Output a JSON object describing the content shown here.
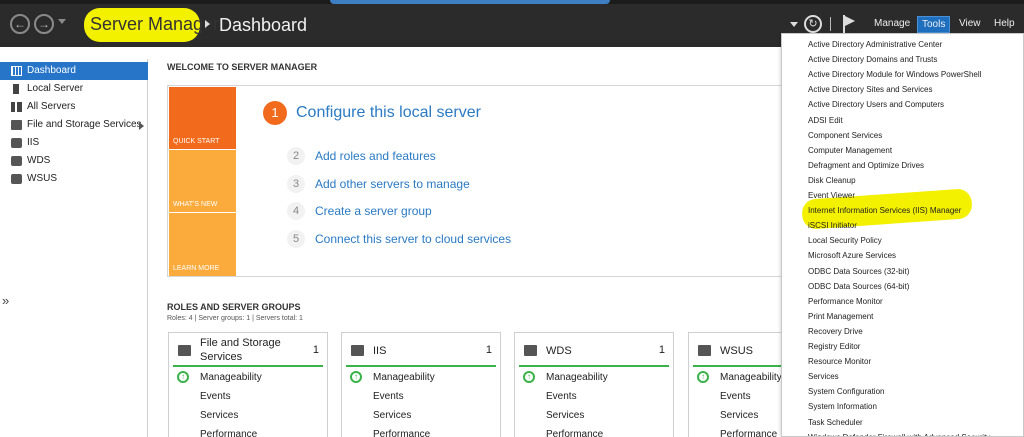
{
  "header": {
    "title": "Server Manager",
    "breadcrumb": "Dashboard",
    "menus": [
      "Manage",
      "Tools",
      "View",
      "Help"
    ]
  },
  "sidebar": {
    "items": [
      {
        "label": "Dashboard",
        "icon": "dashboard-icon",
        "selected": true
      },
      {
        "label": "Local Server",
        "icon": "server-icon"
      },
      {
        "label": "All Servers",
        "icon": "servers-icon"
      },
      {
        "label": "File and Storage Services",
        "icon": "file-storage-icon"
      },
      {
        "label": "IIS",
        "icon": "iis-icon"
      },
      {
        "label": "WDS",
        "icon": "wds-icon"
      },
      {
        "label": "WSUS",
        "icon": "wsus-icon"
      }
    ],
    "collapse_glyph": "»"
  },
  "welcome": {
    "heading": "WELCOME TO SERVER MANAGER",
    "tiles": [
      "QUICK START",
      "WHAT'S NEW",
      "LEARN MORE"
    ],
    "steps": [
      {
        "num": "1",
        "label": "Configure this local server"
      },
      {
        "num": "2",
        "label": "Add roles and features"
      },
      {
        "num": "3",
        "label": "Add other servers to manage"
      },
      {
        "num": "4",
        "label": "Create a server group"
      },
      {
        "num": "5",
        "label": "Connect this server to cloud services"
      }
    ]
  },
  "roles": {
    "heading": "ROLES AND SERVER GROUPS",
    "summary": "Roles: 4   |   Server groups: 1   |   Servers total: 1",
    "cards": [
      {
        "name": "File and Storage Services",
        "count": "1",
        "rows": [
          "Manageability",
          "Events",
          "Services",
          "Performance"
        ]
      },
      {
        "name": "IIS",
        "count": "1",
        "rows": [
          "Manageability",
          "Events",
          "Services",
          "Performance"
        ]
      },
      {
        "name": "WDS",
        "count": "1",
        "rows": [
          "Manageability",
          "Events",
          "Services",
          "Performance"
        ]
      },
      {
        "name": "WSUS",
        "count": "",
        "rows": [
          "Manageability",
          "Events",
          "Services",
          "Performance"
        ]
      }
    ]
  },
  "tools_menu": {
    "items": [
      "Active Directory Administrative Center",
      "Active Directory Domains and Trusts",
      "Active Directory Module for Windows PowerShell",
      "Active Directory Sites and Services",
      "Active Directory Users and Computers",
      "ADSI Edit",
      "Component Services",
      "Computer Management",
      "Defragment and Optimize Drives",
      "Disk Cleanup",
      "Event Viewer",
      "Internet Information Services (IIS) Manager",
      "iSCSI Initiator",
      "Local Security Policy",
      "Microsoft Azure Services",
      "ODBC Data Sources (32-bit)",
      "ODBC Data Sources (64-bit)",
      "Performance Monitor",
      "Print Management",
      "Recovery Drive",
      "Registry Editor",
      "Resource Monitor",
      "Services",
      "System Configuration",
      "System Information",
      "Task Scheduler",
      "Windows Defender Firewall with Advanced Security"
    ],
    "highlighted": "Internet Information Services (IIS) Manager"
  },
  "colors": {
    "accent": "#2675c8",
    "highlight": "#f4f100",
    "quick_start": "#f26a1c",
    "tile": "#fbaa3c",
    "ok": "#3bb34a"
  }
}
